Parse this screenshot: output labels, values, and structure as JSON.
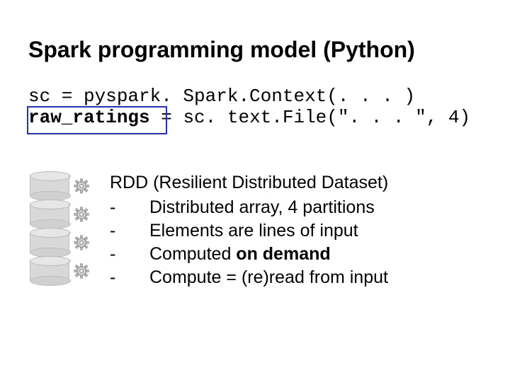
{
  "title": "Spark programming model (Python)",
  "code": {
    "line1": "sc = pyspark. Spark.Context(. . . )",
    "line2_pre": "raw_ratings",
    "line2_post": " = sc. text.File(\". . . \", 4)"
  },
  "bullets": {
    "heading": "RDD (Resilient Distributed Dataset)",
    "items": [
      {
        "pre": "Distributed array, 4 partitions"
      },
      {
        "pre": "Elements are lines of input"
      },
      {
        "pre": "Computed ",
        "bold": "on demand"
      },
      {
        "pre": "Compute = (re)read from input"
      }
    ]
  },
  "icons": {
    "gear": "gear-icon",
    "cylinder": "db-partition"
  }
}
